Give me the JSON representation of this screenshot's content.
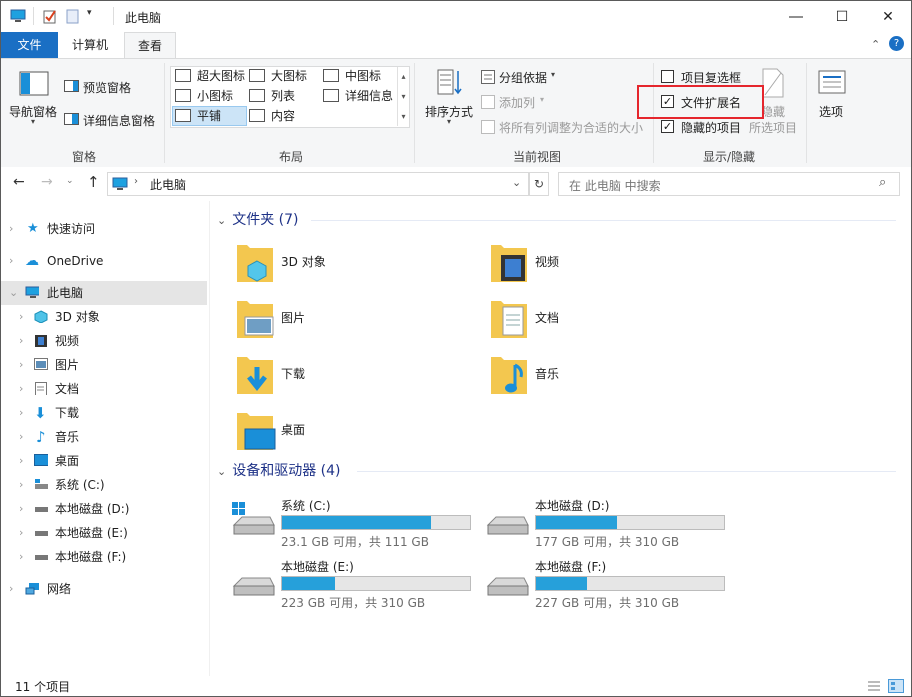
{
  "window": {
    "title": "此电脑"
  },
  "tabs": {
    "file": "文件",
    "computer": "计算机",
    "view": "查看"
  },
  "ribbon": {
    "pane_group": {
      "label": "窗格",
      "nav_pane": "导航窗格",
      "preview_pane": "预览窗格",
      "details_pane": "详细信息窗格"
    },
    "layout_group": {
      "label": "布局",
      "items": [
        "超大图标",
        "大图标",
        "中图标",
        "小图标",
        "列表",
        "详细信息",
        "平铺",
        "内容"
      ],
      "selected": "平铺"
    },
    "current_view_group": {
      "label": "当前视图",
      "sort_by": "排序方式",
      "group_by": "分组依据",
      "add_column": "添加列",
      "size_all_columns": "将所有列调整为合适的大小"
    },
    "show_hide_group": {
      "label": "显示/隐藏",
      "item_checkboxes": {
        "label": "项目复选框",
        "checked": false
      },
      "file_extensions": {
        "label": "文件扩展名",
        "checked": true
      },
      "hidden_items": {
        "label": "隐藏的项目",
        "checked": true
      },
      "hide_selected": "隐藏",
      "hide_selected_sub": "所选项目"
    },
    "options": "选项"
  },
  "address": {
    "path": "此电脑",
    "search_placeholder": "在 此电脑 中搜索"
  },
  "nav": [
    {
      "label": "快速访问"
    },
    {
      "label": "OneDrive"
    },
    {
      "label": "此电脑"
    },
    {
      "label": "3D 对象"
    },
    {
      "label": "视频"
    },
    {
      "label": "图片"
    },
    {
      "label": "文档"
    },
    {
      "label": "下载"
    },
    {
      "label": "音乐"
    },
    {
      "label": "桌面"
    },
    {
      "label": "系统 (C:)"
    },
    {
      "label": "本地磁盘 (D:)"
    },
    {
      "label": "本地磁盘 (E:)"
    },
    {
      "label": "本地磁盘 (F:)"
    },
    {
      "label": "网络"
    }
  ],
  "content": {
    "folders_header": "文件夹 (7)",
    "folders": [
      "3D 对象",
      "视频",
      "图片",
      "文档",
      "下载",
      "音乐",
      "桌面"
    ],
    "drives_header": "设备和驱动器 (4)",
    "drives": [
      {
        "name": "系统 (C:)",
        "info": "23.1 GB 可用，共 111 GB",
        "used_fraction": 0.79
      },
      {
        "name": "本地磁盘 (D:)",
        "info": "177 GB 可用，共 310 GB",
        "used_fraction": 0.43
      },
      {
        "name": "本地磁盘 (E:)",
        "info": "223 GB 可用，共 310 GB",
        "used_fraction": 0.28
      },
      {
        "name": "本地磁盘 (F:)",
        "info": "227 GB 可用，共 310 GB",
        "used_fraction": 0.27
      }
    ]
  },
  "status": {
    "count": "11 个项目"
  },
  "colors": {
    "accent": "#1a6fc4",
    "drive_fill": "#26a0da",
    "highlight_box": "#e5262d",
    "header_text": "#1e3287"
  }
}
